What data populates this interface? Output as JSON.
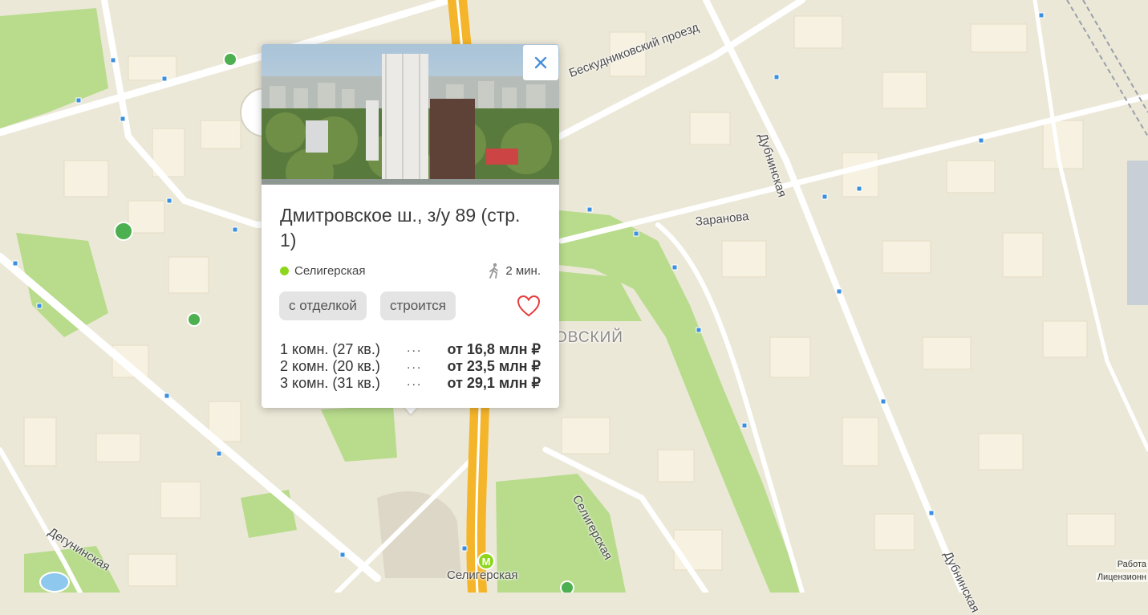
{
  "map": {
    "streets": [
      "Бескудниковский проезд",
      "Дубнинская",
      "Заранова",
      "Селигерская",
      "Дегунинская",
      "Селигерская",
      "Дубнинская"
    ],
    "district_label": "ОВСКИЙ",
    "metro_station_label": "Селигерская",
    "attribution": [
      "Работа",
      "Лицензионн"
    ]
  },
  "popup": {
    "close_label": "×",
    "title": "Дмитровское ш., з/у 89 (стр. 1)",
    "metro": {
      "name": "Селигерская",
      "color": "#8ed61c",
      "walk_time": "2 мин."
    },
    "tags": [
      "с отделкой",
      "строится"
    ],
    "favorite_icon": "heart-outline-icon",
    "prices": [
      {
        "rooms": "1 комн. (27 кв.)",
        "dots": "...",
        "price": "от 16,8 млн ₽"
      },
      {
        "rooms": "2 комн. (20 кв.)",
        "dots": "...",
        "price": "от 23,5 млн ₽"
      },
      {
        "rooms": "3 комн. (31 кв.)",
        "dots": "...",
        "price": "от 29,1 млн ₽"
      }
    ]
  },
  "colors": {
    "map_background": "#ece8d8",
    "park": "#b8dc8c",
    "building": "#f6f1e0",
    "road": "#ffffff",
    "highway": "#f5b52a",
    "metro_line": "#8ed61c",
    "transit_stop": "#3b8fdf",
    "accent_heart": "#e63a3a"
  }
}
